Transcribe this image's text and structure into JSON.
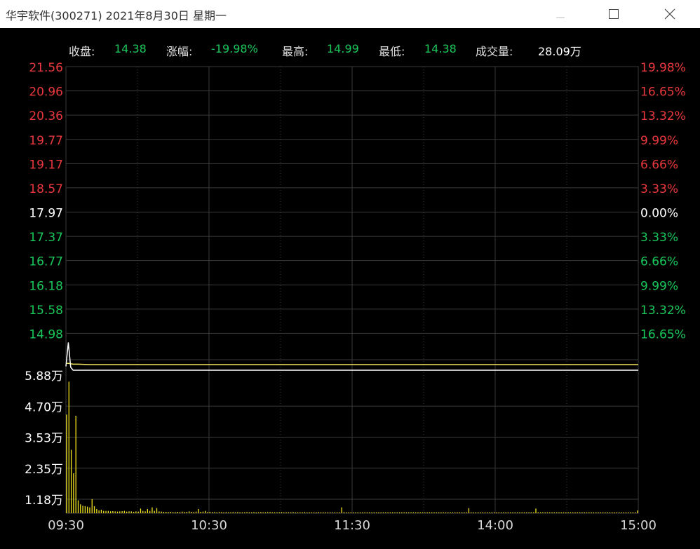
{
  "window": {
    "title": "华宇软件(300271)  2021年8月30日  星期一",
    "minimize_icon": "minimize-icon",
    "maximize_icon": "maximize-icon",
    "close_icon": "close-icon"
  },
  "stats": {
    "close_label": "收盘:",
    "close_value": "14.38",
    "change_label": "涨幅:",
    "change_value": "-19.98%",
    "high_label": "最高:",
    "high_value": "14.99",
    "low_label": "最低:",
    "low_value": "14.38",
    "volume_label": "成交量:",
    "volume_value": "28.09万"
  },
  "colors": {
    "background": "#000000",
    "grid": "#3a3a3a",
    "up": "#e8383d",
    "down": "#19c75a",
    "neutral": "#ffffff",
    "price_line": "#ffffff",
    "avg_line": "#f2e55c",
    "volume_bar": "#f2e51d"
  },
  "chart_data": [
    {
      "type": "line",
      "name": "intraday-price",
      "ylim": [
        14.38,
        21.56
      ],
      "prev_close": 17.97,
      "y_ticks_left": [
        "21.56",
        "20.96",
        "20.36",
        "19.77",
        "19.17",
        "18.57",
        "17.97",
        "17.37",
        "16.77",
        "16.18",
        "15.58",
        "14.98"
      ],
      "y_ticks_right": [
        "19.98%",
        "16.65%",
        "13.32%",
        "9.99%",
        "6.66%",
        "3.33%",
        "0.00%",
        "3.33%",
        "6.66%",
        "9.99%",
        "13.32%",
        "16.65%"
      ],
      "x_ticks": [
        "09:30",
        "10:30",
        "11:30",
        "14:00",
        "15:00"
      ],
      "grid": true,
      "series": [
        {
          "x": [
            0,
            1,
            2,
            3,
            5,
            10,
            60,
            120,
            180,
            240
          ],
          "values": [
            14.42,
            14.99,
            14.4,
            14.38,
            14.38,
            14.38,
            14.38,
            14.38,
            14.38,
            14.38
          ]
        },
        {
          "x": [
            0,
            1,
            2,
            3,
            5,
            10,
            60,
            120,
            180,
            240
          ],
          "values": [
            14.46,
            14.46,
            14.45,
            14.44,
            14.44,
            14.43,
            14.43,
            14.43,
            14.43,
            14.43
          ]
        }
      ]
    },
    {
      "type": "bar",
      "name": "intraday-volume",
      "unit": "万",
      "ylim": [
        0,
        5.88
      ],
      "y_ticks": [
        "5.88万",
        "4.70万",
        "3.53万",
        "2.35万",
        "1.18万"
      ],
      "x_ticks": [
        "09:30",
        "10:30",
        "11:30",
        "14:00",
        "15:00"
      ],
      "values": [
        4.2,
        5.6,
        2.7,
        1.7,
        4.15,
        0.55,
        0.38,
        0.32,
        0.3,
        0.28,
        0.25,
        0.6,
        0.3,
        0.18,
        0.12,
        0.15,
        0.1,
        0.1,
        0.1,
        0.08,
        0.09,
        0.08,
        0.07,
        0.08,
        0.09,
        0.1,
        0.07,
        0.08,
        0.08,
        0.06,
        0.08,
        0.07,
        0.2,
        0.1,
        0.08,
        0.18,
        0.1,
        0.25,
        0.1,
        0.22,
        0.08,
        0.07,
        0.06,
        0.06,
        0.05,
        0.06,
        0.05,
        0.05,
        0.06,
        0.05,
        0.07,
        0.05,
        0.06,
        0.08,
        0.06,
        0.05,
        0.07,
        0.18,
        0.06,
        0.07,
        0.1,
        0.05,
        0.06,
        0.05,
        0.05,
        0.04,
        0.05,
        0.05,
        0.04,
        0.05,
        0.04,
        0.04,
        0.05,
        0.04,
        0.05,
        0.04,
        0.04,
        0.04,
        0.05,
        0.04,
        0.04,
        0.05,
        0.04,
        0.04,
        0.05,
        0.04,
        0.04,
        0.05,
        0.05,
        0.04,
        0.04,
        0.04,
        0.04,
        0.05,
        0.04,
        0.04,
        0.04,
        0.04,
        0.05,
        0.04,
        0.04,
        0.04,
        0.04,
        0.05,
        0.04,
        0.04,
        0.04,
        0.04,
        0.04,
        0.05,
        0.04,
        0.04,
        0.04,
        0.04,
        0.04,
        0.04,
        0.04,
        0.04,
        0.04,
        0.25,
        0.05,
        0.04,
        0.04,
        0.04,
        0.04,
        0.04,
        0.04,
        0.04,
        0.04,
        0.04,
        0.04,
        0.04,
        0.04,
        0.04,
        0.04,
        0.04,
        0.04,
        0.04,
        0.04,
        0.04,
        0.04,
        0.04,
        0.04,
        0.04,
        0.04,
        0.04,
        0.04,
        0.04,
        0.04,
        0.04,
        0.04,
        0.04,
        0.04,
        0.04,
        0.04,
        0.04,
        0.04,
        0.04,
        0.04,
        0.04,
        0.04,
        0.04,
        0.04,
        0.04,
        0.04,
        0.04,
        0.04,
        0.04,
        0.04,
        0.04,
        0.04,
        0.04,
        0.04,
        0.04,
        0.22,
        0.04,
        0.04,
        0.04,
        0.04,
        0.04,
        0.04,
        0.04,
        0.04,
        0.04,
        0.04,
        0.04,
        0.04,
        0.04,
        0.04,
        0.04,
        0.04,
        0.04,
        0.04,
        0.04,
        0.04,
        0.04,
        0.04,
        0.04,
        0.04,
        0.04,
        0.04,
        0.04,
        0.04,
        0.2,
        0.04,
        0.04,
        0.04,
        0.04,
        0.04,
        0.04,
        0.04,
        0.04,
        0.04,
        0.04,
        0.04,
        0.04,
        0.04,
        0.04,
        0.04,
        0.04,
        0.04,
        0.04,
        0.04,
        0.04,
        0.04,
        0.04,
        0.04,
        0.04,
        0.04,
        0.04,
        0.04,
        0.04,
        0.04,
        0.04,
        0.04,
        0.04,
        0.04,
        0.04,
        0.04,
        0.04,
        0.04,
        0.04,
        0.04,
        0.04,
        0.04,
        0.04,
        0.04,
        0.12
      ]
    }
  ]
}
